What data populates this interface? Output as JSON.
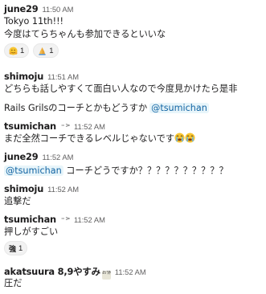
{
  "messages": [
    {
      "author": "june29",
      "time": "11:50 AM",
      "lines": [
        "Tokyo 11th!!!",
        "今度はてらちゃんも参加できるといいな"
      ],
      "reactions": [
        {
          "emoji": "hugging-face-icon",
          "count": "1"
        },
        {
          "emoji": "folded-hands-icon",
          "count": "1"
        }
      ]
    },
    {
      "author": "shimoju",
      "time": "11:51 AM",
      "lines": [
        "どちらも話しやすくて面白い人なので今度見かけたら是非",
        "Rails Grilsのコーチとかもどうすか"
      ],
      "mention": "@tsumichan"
    },
    {
      "author": "tsumichan",
      "time": "11:52 AM",
      "lines": [
        "まだ全然コーチできるレベルじゃないです"
      ],
      "inline_emoji": [
        "sob-icon",
        "sob-icon"
      ]
    },
    {
      "author": "june29",
      "time": "11:52 AM",
      "mention": "@tsumichan",
      "lines": [
        "コーチどうですか？？？？？？？？？？"
      ]
    },
    {
      "author": "shimoju",
      "time": "11:52 AM",
      "lines": [
        "追撃だ"
      ]
    },
    {
      "author": "tsumichan",
      "time": "11:52 AM",
      "lines": [
        "押しがすごい"
      ],
      "reactions": [
        {
          "emoji": "kanji-strong-icon",
          "label": "強",
          "count": "1"
        }
      ]
    },
    {
      "author": "akatsuura 8,9やすみ",
      "badge": "お休み",
      "time": "11:52 AM",
      "lines": [
        "圧だ"
      ]
    }
  ]
}
